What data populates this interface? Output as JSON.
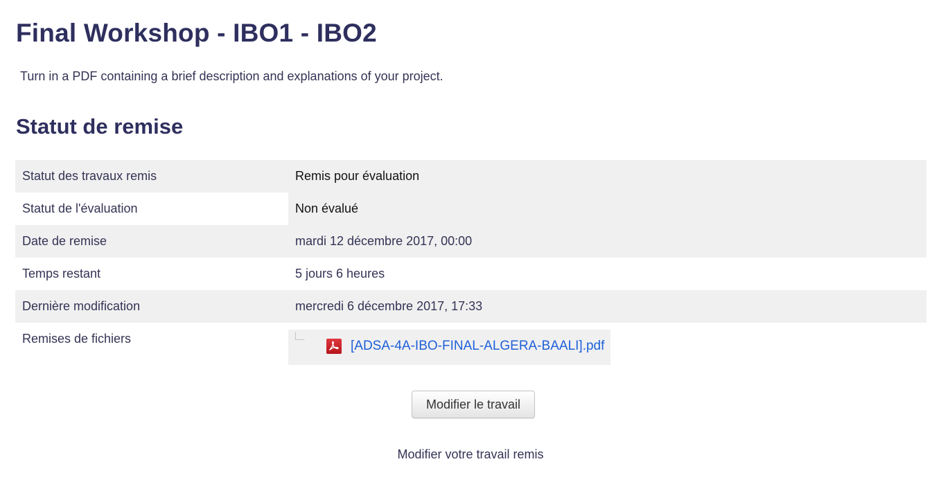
{
  "page": {
    "title": "Final Workshop - IBO1 - IBO2",
    "intro": "Turn in a PDF containing a brief description and explanations of your project."
  },
  "submission_status": {
    "heading": "Statut de remise",
    "rows": [
      {
        "label": "Statut des travaux remis",
        "value": "Remis pour évaluation"
      },
      {
        "label": "Statut de l'évaluation",
        "value": "Non évalué"
      },
      {
        "label": "Date de remise",
        "value": "mardi 12 décembre 2017, 00:00"
      },
      {
        "label": "Temps restant",
        "value": "5 jours 6 heures"
      },
      {
        "label": "Dernière modification",
        "value": "mercredi 6 décembre 2017, 17:33"
      },
      {
        "label": "Remises de fichiers",
        "value": ""
      }
    ],
    "file": {
      "name": "[ADSA-4A-IBO-FINAL-ALGERA-BAALI].pdf",
      "icon": "pdf-icon"
    }
  },
  "actions": {
    "edit_button": "Modifier le travail",
    "edit_caption": "Modifier votre travail remis"
  },
  "colors": {
    "heading": "#2e2f5e",
    "link": "#1e60d8",
    "row_shade": "#f0f0f0"
  }
}
